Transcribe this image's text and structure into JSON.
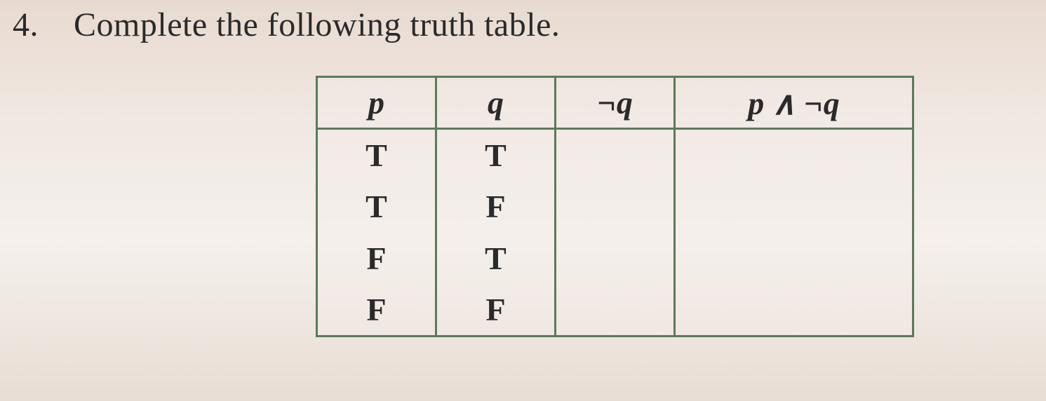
{
  "question": {
    "number": "4.",
    "text": "Complete the following truth table."
  },
  "table": {
    "headers": {
      "p": "p",
      "q": "q",
      "not_q": "¬q",
      "p_and_not_q": "p ∧ ¬q"
    },
    "rows": [
      {
        "p": "T",
        "q": "T",
        "not_q": "",
        "p_and_not_q": ""
      },
      {
        "p": "T",
        "q": "F",
        "not_q": "",
        "p_and_not_q": ""
      },
      {
        "p": "F",
        "q": "T",
        "not_q": "",
        "p_and_not_q": ""
      },
      {
        "p": "F",
        "q": "F",
        "not_q": "",
        "p_and_not_q": ""
      }
    ]
  },
  "chart_data": {
    "type": "table",
    "title": "Truth table for p ∧ ¬q (to be completed)",
    "columns": [
      "p",
      "q",
      "¬q",
      "p ∧ ¬q"
    ],
    "rows": [
      [
        "T",
        "T",
        "",
        ""
      ],
      [
        "T",
        "F",
        "",
        ""
      ],
      [
        "F",
        "T",
        "",
        ""
      ],
      [
        "F",
        "F",
        "",
        ""
      ]
    ]
  }
}
